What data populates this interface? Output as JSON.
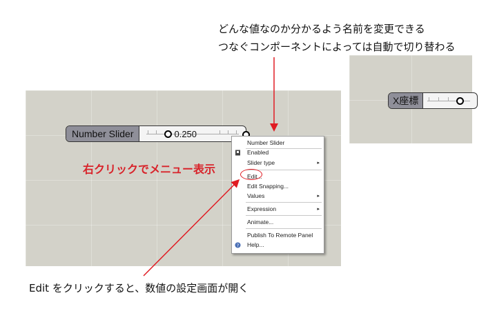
{
  "annotations": {
    "top_line1": "どんな値なのか分かるよう名前を変更できる",
    "top_line2": "つなぐコンポーネントによっては自動で切り替わる",
    "right_click": "右クリックでメニュー表示",
    "bottom": "Edit をクリックすると、数値の設定画面が開く"
  },
  "slider_main": {
    "label": "Number Slider",
    "value": "0.250",
    "position_fraction": 0.25
  },
  "slider_zoom": {
    "label": "X座標"
  },
  "context_menu": {
    "items": [
      {
        "label": "Number Slider",
        "icon": "none"
      },
      {
        "label": "Enabled",
        "icon": "enabled-icon"
      },
      {
        "label": "Slider type",
        "submenu": "▸"
      },
      {
        "label": "Edit..."
      },
      {
        "label": "Edit Snapping..."
      },
      {
        "label": "Values",
        "submenu": "▸"
      },
      {
        "label": "Expression",
        "submenu": "▸"
      },
      {
        "label": "Animate..."
      },
      {
        "label": "Publish To Remote Panel"
      },
      {
        "label": "Help...",
        "icon": "help-icon"
      }
    ]
  },
  "colors": {
    "annotation_red": "#d8232a",
    "canvas": "#d3d2c9",
    "slider_label_bg": "#8f8f99"
  }
}
